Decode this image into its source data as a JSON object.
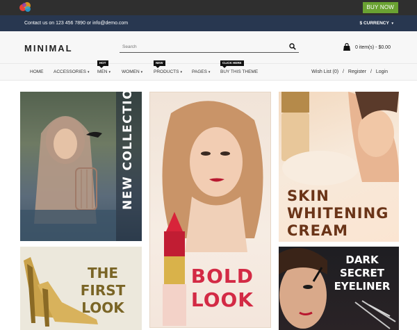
{
  "topbar": {
    "buy_now_label": "BUY NOW",
    "accent_color": "#6aa232"
  },
  "infobar": {
    "contact_text": "Contact us on 123 456 7890 or info@demo.com",
    "currency_label": "$ CURRENCY"
  },
  "header": {
    "brand": "MINIMAL",
    "search": {
      "placeholder": "Search"
    },
    "cart_text": "0 item(s) - $0.00"
  },
  "nav": {
    "items": [
      {
        "label": "HOME",
        "has_caret": false,
        "badge": ""
      },
      {
        "label": "ACCESSORIES",
        "has_caret": true,
        "badge": ""
      },
      {
        "label": "MEN",
        "has_caret": true,
        "badge": "HOT"
      },
      {
        "label": "WOMEN",
        "has_caret": true,
        "badge": ""
      },
      {
        "label": "PRODUCTS",
        "has_caret": true,
        "badge": "NEW"
      },
      {
        "label": "PAGES",
        "has_caret": true,
        "badge": ""
      },
      {
        "label": "BUY THIS THEME",
        "has_caret": false,
        "badge": "CLICK HERE"
      }
    ],
    "wishlist": "Wish List (0)",
    "register": "Register",
    "login": "Login",
    "separator": "/",
    "caret": "▾"
  },
  "banners": {
    "collection": {
      "text": "NEW COLLECTION"
    },
    "bold_look": {
      "line1": "BOLD",
      "line2": "LOOK",
      "color": "#d32a45"
    },
    "skin": {
      "line1": "SKIN",
      "line2": "WHITENING",
      "line3": "CREAM",
      "color": "#6a3418"
    },
    "first_look": {
      "line1": "THE FIRST",
      "line2": "LOOK",
      "color": "#7a6526"
    },
    "eyeliner": {
      "line1": "DARK SECRET",
      "line2": "EYELINER"
    }
  },
  "icons": {
    "search": "search-icon",
    "cart": "cart-icon",
    "logo": "logo-icon"
  }
}
